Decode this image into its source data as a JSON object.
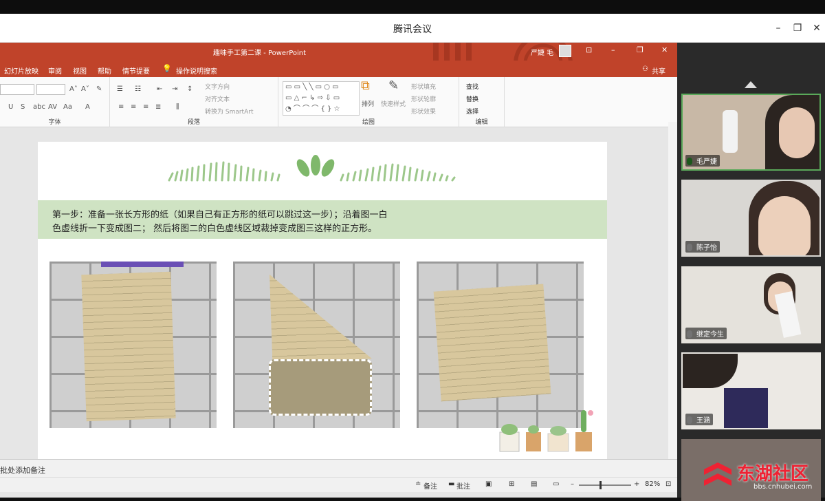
{
  "window": {
    "title": "腾讯会议"
  },
  "ppt": {
    "doc_title": "趣味手工第二课 - PowerPoint",
    "user": "严婕 毛",
    "menu": [
      "幻灯片放映",
      "审阅",
      "视图",
      "帮助",
      "情节提要",
      "操作说明搜索"
    ],
    "share_label": "共享",
    "ribbon": {
      "groups": [
        "字体",
        "段落",
        "绘图",
        "编辑"
      ],
      "paragraph": {
        "text_direction": "文字方向",
        "align_text": "对齐文本",
        "smartart": "转换为 SmartArt"
      },
      "drawing": {
        "arrange": "排列",
        "quick_styles": "快速样式",
        "shape_fill": "形状填充",
        "shape_outline": "形状轮廓",
        "shape_effects": "形状效果"
      },
      "editing": {
        "find": "查找",
        "replace": "替换",
        "select": "选择"
      }
    },
    "slide": {
      "step_line1": "第一步：准备一张长方形的纸（如果自己有正方形的纸可以跳过这一步）；沿着图一白",
      "step_line2": "色虚线折一下变成图二； 然后将图二的白色虚线区域裁掉变成图三这样的正方形。"
    },
    "notes_placeholder": "批处添加备注",
    "status": {
      "notes": "备注",
      "comments": "批注",
      "zoom": "82%"
    }
  },
  "participants": [
    {
      "name": "毛严婕",
      "mic": "on",
      "camera": "active"
    },
    {
      "name": "陈子怡",
      "mic": "muted",
      "camera": "off"
    },
    {
      "name": "继定今生",
      "mic": "muted",
      "camera": "off"
    },
    {
      "name": "王涵",
      "mic": "muted",
      "camera": "off"
    }
  ],
  "watermark": {
    "brand": "东湖社区",
    "url": "bbs.cnhubei.com"
  },
  "colors": {
    "ppt_red": "#c0432a",
    "slide_band": "#cfe3c3",
    "speaking": "#5aa95a"
  }
}
